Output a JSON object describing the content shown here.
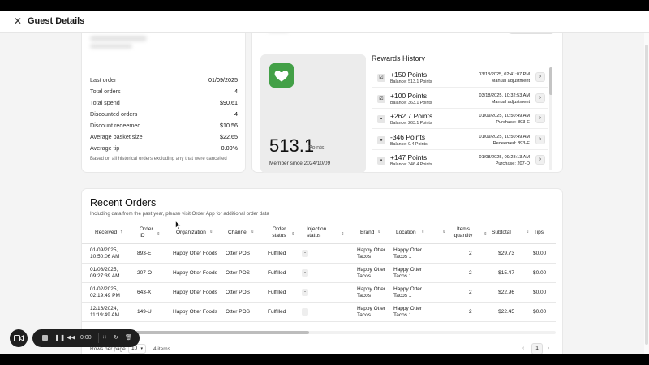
{
  "header": {
    "close_icon": "close-icon",
    "title": "Guest Details"
  },
  "stats": {
    "rows": [
      {
        "label": "Last order",
        "value": "01/09/2025"
      },
      {
        "label": "Total orders",
        "value": "4"
      },
      {
        "label": "Total spend",
        "value": "$90.61"
      },
      {
        "label": "Discounted orders",
        "value": "4"
      },
      {
        "label": "Discount redeemed",
        "value": "$10.56"
      },
      {
        "label": "Average basket size",
        "value": "$22.65"
      },
      {
        "label": "Average tip",
        "value": "0.00%"
      }
    ],
    "note": "Based on all historical orders excluding any that were cancelled"
  },
  "rewards": {
    "points_value": "513.1",
    "points_unit": "Points",
    "member_since": "Member since 2024/10/09",
    "history_title": "Rewards History",
    "history": [
      {
        "icon": "check-square-icon",
        "points": "+150 Points",
        "balance": "Balance: 513.1 Points",
        "date": "03/18/2025, 02:41:07 PM",
        "desc": "Manual adjustment"
      },
      {
        "icon": "check-square-icon",
        "points": "+100 Points",
        "balance": "Balance: 363.1 Points",
        "date": "03/18/2025, 10:32:53 AM",
        "desc": "Manual adjustment"
      },
      {
        "icon": "bag-icon",
        "points": "+262.7 Points",
        "balance": "Balance: 263.1 Points",
        "date": "01/09/2025, 10:50:49 AM",
        "desc": "Purchase: 893-E"
      },
      {
        "icon": "coin-icon",
        "points": "-346 Points",
        "balance": "Balance: 0.4 Points",
        "date": "01/09/2025, 10:50:49 AM",
        "desc": "Redeemed: 893-E"
      },
      {
        "icon": "bag-icon",
        "points": "+147 Points",
        "balance": "Balance: 346.4 Points",
        "date": "01/08/2025, 09:28:13 AM",
        "desc": "Purchase: 207-O"
      }
    ]
  },
  "orders": {
    "title": "Recent Orders",
    "subtitle": "Including data from the past year, please visit Order App for additional order data",
    "columns": [
      "Received",
      "Order ID",
      "Organization",
      "Channel",
      "Order status",
      "Injection status",
      "Brand",
      "Location",
      "Items quantity",
      "Subtotal",
      "Tips"
    ],
    "rows": [
      {
        "received": "01/09/2025, 10:50:06 AM",
        "order_id": "893-E",
        "organization": "Happy Otter Foods",
        "channel": "Otter POS",
        "status": "Fulfilled",
        "injection": "-",
        "brand": "Happy Otter Tacos",
        "location": "Happy Otter Tacos 1",
        "qty": "2",
        "subtotal": "$29.73",
        "tips": "$0.00"
      },
      {
        "received": "01/08/2025, 09:27:39 AM",
        "order_id": "207-O",
        "organization": "Happy Otter Foods",
        "channel": "Otter POS",
        "status": "Fulfilled",
        "injection": "-",
        "brand": "Happy Otter Tacos",
        "location": "Happy Otter Tacos 1",
        "qty": "2",
        "subtotal": "$15.47",
        "tips": "$0.00"
      },
      {
        "received": "01/02/2025, 02:19:49 PM",
        "order_id": "643-X",
        "organization": "Happy Otter Foods",
        "channel": "Otter POS",
        "status": "Fulfilled",
        "injection": "-",
        "brand": "Happy Otter Tacos",
        "location": "Happy Otter Tacos 1",
        "qty": "2",
        "subtotal": "$22.96",
        "tips": "$0.00"
      },
      {
        "received": "12/16/2024, 11:19:49 AM",
        "order_id": "149-U",
        "organization": "Happy Otter Foods",
        "channel": "Otter POS",
        "status": "Fulfilled",
        "injection": "-",
        "brand": "Happy Otter Tacos",
        "location": "Happy Otter Tacos 1",
        "qty": "2",
        "subtotal": "$22.45",
        "tips": "$0.00"
      }
    ],
    "rows_per_page_label": "Rows per page",
    "rows_per_page": "10",
    "items_count": "4 items",
    "current_page": "1"
  },
  "recorder": {
    "time": "0:00"
  },
  "colors": {
    "brand_green": "#43a047"
  }
}
